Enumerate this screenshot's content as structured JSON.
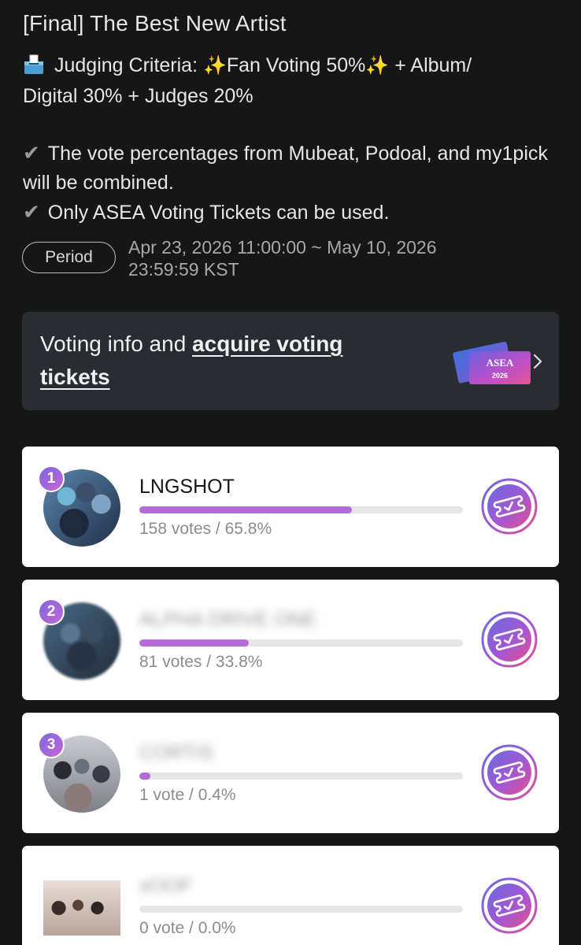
{
  "title": "[Final] The Best New Artist",
  "criteria": {
    "icon": "ballot-box-icon",
    "prefix": "Judging Criteria:",
    "fan_voting": "Fan Voting 50%",
    "rest_line1": "+ Album/",
    "rest_line2": "Digital 30% + Judges 20%"
  },
  "notes": [
    "The vote percentages from Mubeat, Podoal, and my1pick will be combined.",
    "Only ASEA Voting Tickets can be used."
  ],
  "period": {
    "label": "Period",
    "line1": "Apr 23, 2026 11:00:00 ~ May 10, 2026",
    "line2": "23:59:59 KST"
  },
  "banner": {
    "text_plain": "Voting info and ",
    "text_link": "acquire voting tickets",
    "ticket_logo": "ASEA",
    "ticket_year": "2026"
  },
  "candidates": [
    {
      "rank": "1",
      "name": "LNGSHOT",
      "blurred": false,
      "share": 0.658,
      "votes_text": "158 votes / 65.8%"
    },
    {
      "rank": "2",
      "name": "ALPHA DRIVE ONE",
      "blurred": true,
      "share": 0.338,
      "votes_text": "81 votes / 33.8%"
    },
    {
      "rank": "3",
      "name": "CORTIS",
      "blurred": true,
      "share": 0.004,
      "votes_text": "1 vote / 0.4%"
    },
    {
      "rank": "",
      "name": "xOOF",
      "blurred": true,
      "share": 0.0,
      "votes_text": "0 vote / 0.0%"
    }
  ],
  "colors": {
    "accent_bar": "#b46ad9",
    "rank_gradient_start": "#7d67e0",
    "rank_gradient_end": "#c566d6"
  }
}
